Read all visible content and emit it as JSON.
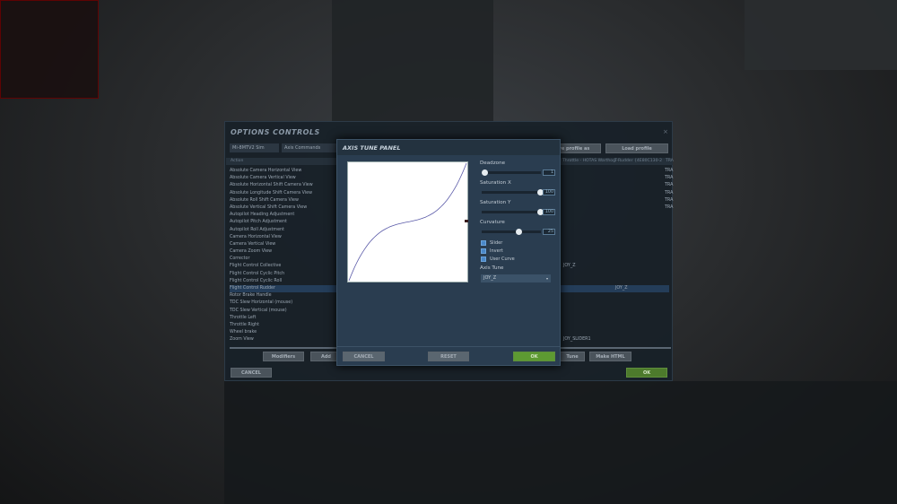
{
  "window": {
    "title": "OPTIONS CONTROLS",
    "close": "×",
    "aircraft": "Mi-8MTV2 Sim",
    "category": "Axis Commands",
    "save_profile": "Save profile as",
    "load_profile": "Load profile",
    "columns": [
      "Action",
      "Throttle - HOTAS Warthog",
      "T-Rudder {4E80C130-2",
      "TRA"
    ],
    "actions": [
      "Absolute Camera Horizontal View",
      "Absolute Camera Vertical View",
      "Absolute Horizontal Shift Camera View",
      "Absolute Longitude Shift Camera View",
      "Absolute Roll Shift Camera View",
      "Absolute Vertical Shift Camera View",
      "Autopilot Heading Adjustment",
      "Autopilot Pitch Adjustment",
      "Autopilot Roll Adjustment",
      "Camera Horizontal View",
      "Camera Vertical View",
      "Camera Zoom View",
      "Corrector",
      "Flight Control Collective",
      "Flight Control Cyclic Pitch",
      "Flight Control Cyclic Roll",
      "Flight Control Rudder",
      "Rotor Brake Handle",
      "TDC Slew Horizontal (mouse)",
      "TDC Slew Vertical (mouse)",
      "Throttle Left",
      "Throttle Right",
      "Wheel brake",
      "Zoom View"
    ],
    "col3_values": [
      "TRA",
      "TRA",
      "TRA",
      "TRA",
      "TRA",
      "TRA"
    ],
    "collective_bind": "JOY_Z",
    "rudder_bind": "JOY_Z",
    "zoom_bind": "JOY_SLIDER1",
    "modifiers": "Modifiers",
    "add": "Add",
    "tune": "Tune",
    "make_html": "Make HTML",
    "cancel": "CANCEL",
    "ok": "OK"
  },
  "panel": {
    "title": "AXIS TUNE PANEL",
    "deadzone_label": "Deadzone",
    "deadzone": "1",
    "satx_label": "Saturation X",
    "satx": "100",
    "saty_label": "Saturation Y",
    "saty": "100",
    "curv_label": "Curvature",
    "curv": "25",
    "slider": "Slider",
    "invert": "Invert",
    "user_curve": "User Curve",
    "axis_tune_label": "Axis Tune",
    "axis_tune_value": "JOY_Z",
    "cancel": "CANCEL",
    "reset": "RESET",
    "ok": "OK",
    "curve_color": "#5a5aa8"
  }
}
